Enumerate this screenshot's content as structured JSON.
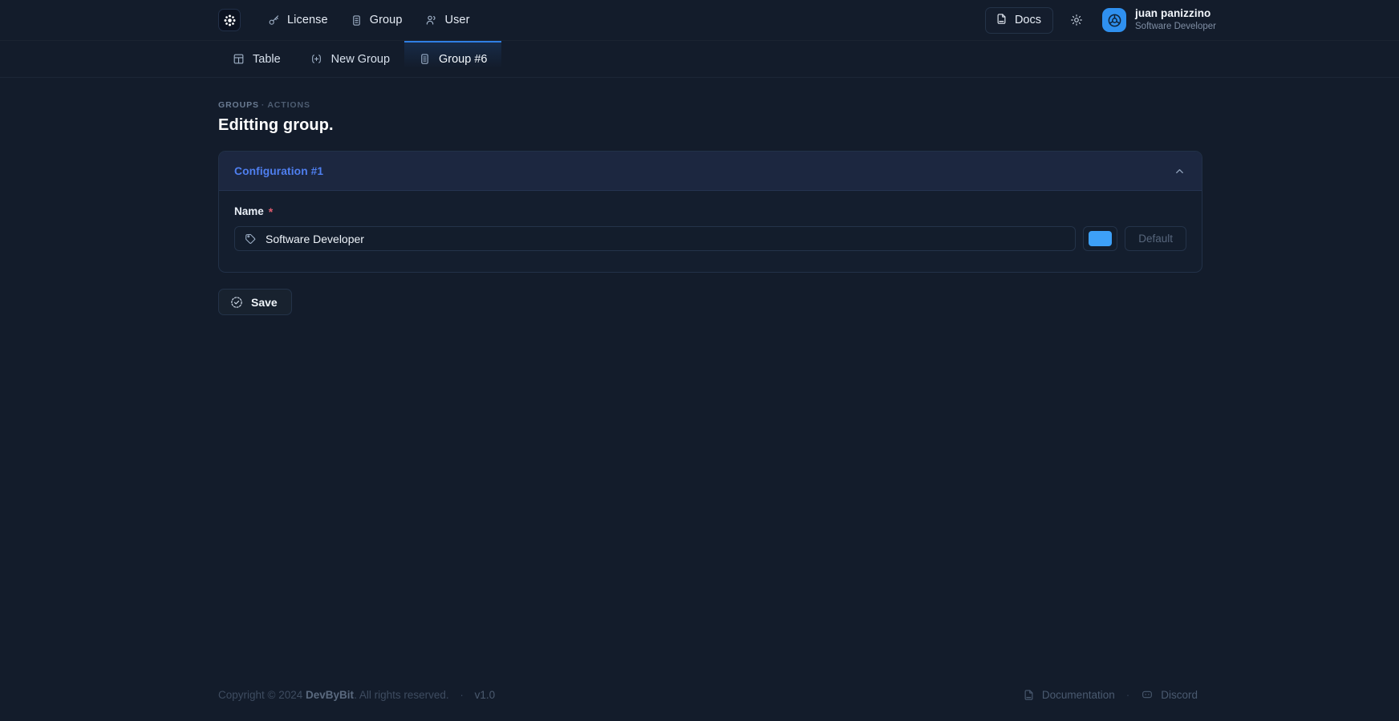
{
  "app": {
    "logo_icon": "snowflake-logo-icon"
  },
  "topnav": {
    "items": [
      {
        "label": "License",
        "icon": "key-icon"
      },
      {
        "label": "Group",
        "icon": "clipboard-icon"
      },
      {
        "label": "User",
        "icon": "users-icon"
      }
    ],
    "docs_label": "Docs",
    "docs_icon": "doc-file-icon",
    "theme_icon": "sun-icon",
    "user": {
      "name": "juan panizzino",
      "role": "Software Developer",
      "avatar_icon": "avatar-icon",
      "avatar_color": "#2f90ef"
    }
  },
  "tabs": [
    {
      "label": "Table",
      "icon": "table-icon",
      "active": false
    },
    {
      "label": "New Group",
      "icon": "plus-brackets-icon",
      "active": false
    },
    {
      "label": "Group #6",
      "icon": "clipboard-icon",
      "active": true
    }
  ],
  "main": {
    "breadcrumb": {
      "first": "GROUPS",
      "separator": "·",
      "second": "ACTIONS"
    },
    "title": "Editting group.",
    "card": {
      "title": "Configuration #1",
      "collapse_icon": "chevron-up-icon",
      "field": {
        "label": "Name",
        "required_marker": "*",
        "icon": "tag-icon",
        "value": "Software Developer",
        "placeholder": "Name",
        "color_value": "#3da0f7",
        "default_label": "Default"
      }
    },
    "save": {
      "label": "Save",
      "icon": "check-circle-dashed-icon"
    }
  },
  "footer": {
    "copyright_prefix": "Copyright © 2024",
    "brand": "DevByBit",
    "copyright_suffix": ". All rights reserved.",
    "separator": "·",
    "version": "v1.0",
    "links": [
      {
        "label": "Documentation",
        "icon": "doc-file-icon"
      },
      {
        "label": "Discord",
        "icon": "discord-icon"
      }
    ],
    "link_separator": "·"
  }
}
